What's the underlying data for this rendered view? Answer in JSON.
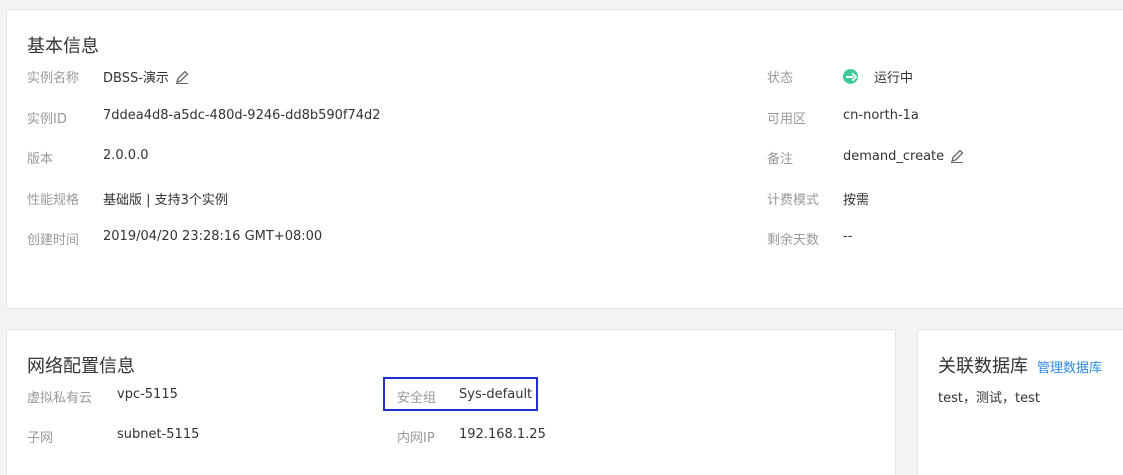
{
  "basic_info": {
    "title": "基本信息",
    "left_fields": [
      {
        "label": "实例名称",
        "value": "DBSS-演示"
      },
      {
        "label": "实例ID",
        "value": "7ddea4d8-a5dc-480d-9246-dd8b590f74d2"
      },
      {
        "label": "版本",
        "value": "2.0.0.0"
      },
      {
        "label": "性能规格",
        "value": "基础版 | 支持3个实例"
      },
      {
        "label": "创建时间",
        "value": "2019/04/20 23:28:16 GMT+08:00"
      }
    ],
    "right_fields": [
      {
        "label": "状态",
        "value": "运行中"
      },
      {
        "label": "可用区",
        "value": "cn-north-1a"
      },
      {
        "label": "备注",
        "value": "demand_create"
      },
      {
        "label": "计费模式",
        "value": "按需"
      },
      {
        "label": "剩余天数",
        "value": "--"
      }
    ]
  },
  "network_info": {
    "title": "网络配置信息",
    "fields": [
      {
        "label": "虚拟私有云",
        "value": "vpc-5115"
      },
      {
        "label": "安全组",
        "value": "Sys-default"
      },
      {
        "label": "子网",
        "value": "subnet-5115"
      },
      {
        "label": "内网IP",
        "value": "192.168.1.25"
      }
    ]
  },
  "related_db": {
    "title": "关联数据库",
    "manage_link": "管理数据库",
    "databases": "test，测试，test"
  },
  "colors": {
    "status_running": "#3ec99b",
    "link": "#2f8ae5",
    "highlight": "#1f2ecf"
  }
}
